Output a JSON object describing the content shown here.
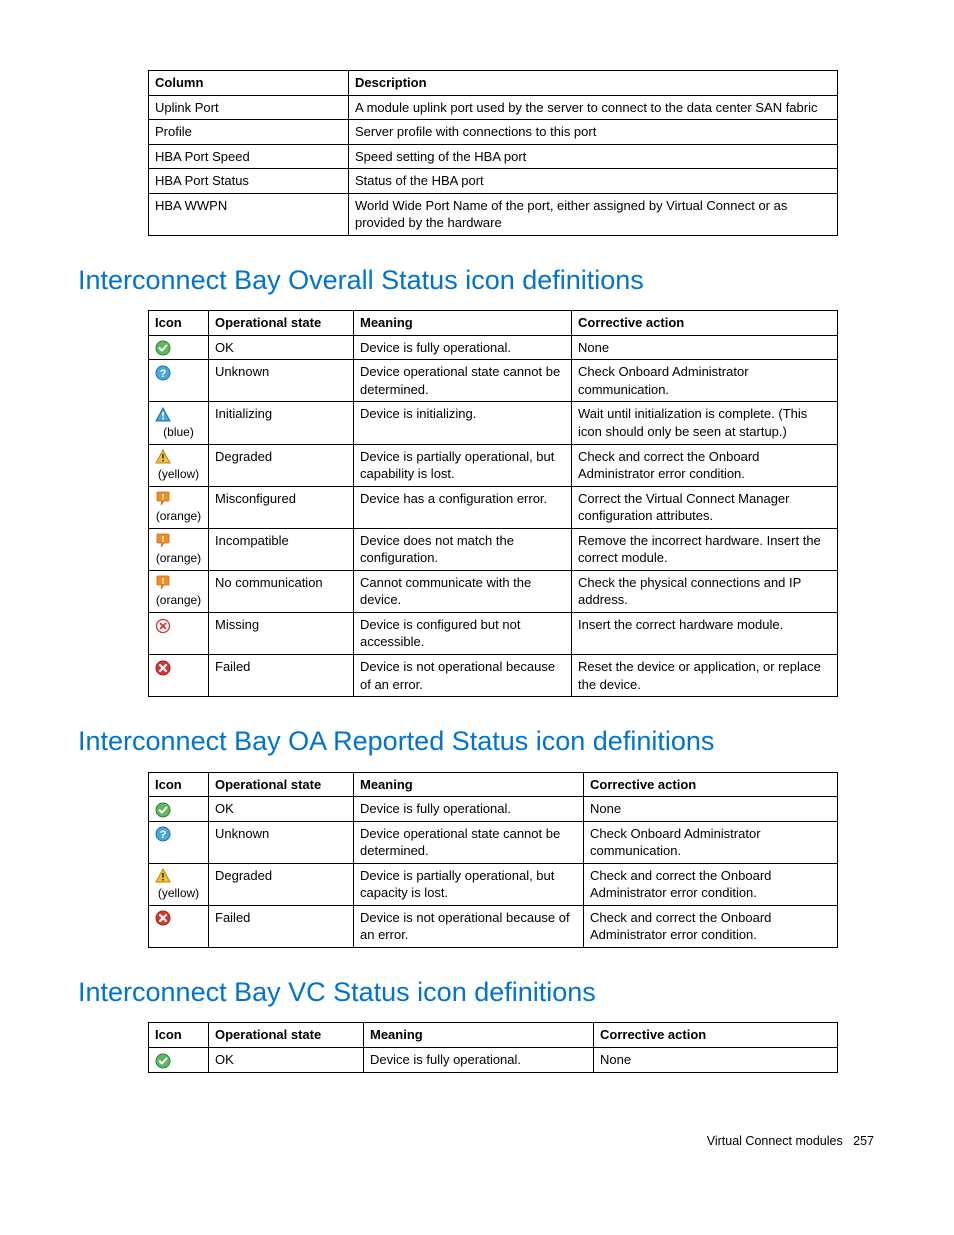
{
  "table1": {
    "headers": [
      "Column",
      "Description"
    ],
    "rows": [
      [
        "Uplink Port",
        "A module uplink port used by the server to connect to the data center SAN fabric"
      ],
      [
        "Profile",
        "Server profile with connections to this port"
      ],
      [
        "HBA Port Speed",
        "Speed setting of the HBA port"
      ],
      [
        "HBA Port Status",
        "Status of the HBA port"
      ],
      [
        "HBA WWPN",
        "World Wide Port Name of the port, either assigned by Virtual Connect or as provided by the hardware"
      ]
    ]
  },
  "section1_title": "Interconnect Bay Overall Status icon definitions",
  "table2": {
    "headers": [
      "Icon",
      "Operational state",
      "Meaning",
      "Corrective action"
    ],
    "rows": [
      {
        "icon": "ok",
        "label": "",
        "state": "OK",
        "meaning": "Device is fully operational.",
        "action": "None"
      },
      {
        "icon": "unknown",
        "label": "",
        "state": "Unknown",
        "meaning": "Device operational state cannot be determined.",
        "action": "Check Onboard Administrator communication."
      },
      {
        "icon": "warn-blue",
        "label": "(blue)",
        "state": "Initializing",
        "meaning": "Device is initializing.",
        "action": "Wait until initialization is complete. (This icon should only be seen at startup.)"
      },
      {
        "icon": "warn-yellow",
        "label": "(yellow)",
        "state": "Degraded",
        "meaning": "Device is partially operational, but capability is lost.",
        "action": "Check and correct the Onboard Administrator error condition."
      },
      {
        "icon": "balloon-orange",
        "label": "(orange)",
        "state": "Misconfigured",
        "meaning": "Device has a configuration error.",
        "action": "Correct the Virtual Connect Manager configuration attributes."
      },
      {
        "icon": "balloon-orange",
        "label": "(orange)",
        "state": "Incompatible",
        "meaning": "Device does not match the configuration.",
        "action": "Remove the incorrect hardware. Insert the correct module."
      },
      {
        "icon": "balloon-orange",
        "label": "(orange)",
        "state": "No communication",
        "meaning": "Cannot communicate with the device.",
        "action": "Check the physical connections and IP address."
      },
      {
        "icon": "missing",
        "label": "",
        "state": "Missing",
        "meaning": "Device is configured but not accessible.",
        "action": "Insert the correct hardware module."
      },
      {
        "icon": "failed",
        "label": "",
        "state": "Failed",
        "meaning": "Device is not operational because of an error.",
        "action": "Reset the device or application, or replace the device."
      }
    ]
  },
  "section2_title": "Interconnect Bay OA Reported Status icon definitions",
  "table3": {
    "headers": [
      "Icon",
      "Operational state",
      "Meaning",
      "Corrective action"
    ],
    "rows": [
      {
        "icon": "ok",
        "label": "",
        "state": "OK",
        "meaning": "Device is fully operational.",
        "action": "None"
      },
      {
        "icon": "unknown",
        "label": "",
        "state": "Unknown",
        "meaning": "Device operational state cannot be determined.",
        "action": "Check Onboard Administrator communication."
      },
      {
        "icon": "warn-yellow",
        "label": "(yellow)",
        "state": "Degraded",
        "meaning": "Device is partially operational, but capacity is lost.",
        "action": "Check and correct the Onboard Administrator error condition."
      },
      {
        "icon": "failed",
        "label": "",
        "state": "Failed",
        "meaning": "Device is not operational because of an error.",
        "action": "Check and correct the Onboard Administrator error condition."
      }
    ]
  },
  "section3_title": "Interconnect Bay VC Status icon definitions",
  "table4": {
    "headers": [
      "Icon",
      "Operational state",
      "Meaning",
      "Corrective action"
    ],
    "rows": [
      {
        "icon": "ok",
        "label": "",
        "state": "OK",
        "meaning": "Device is fully operational.",
        "action": "None"
      }
    ]
  },
  "footer": {
    "text": "Virtual Connect modules",
    "page": "257"
  }
}
